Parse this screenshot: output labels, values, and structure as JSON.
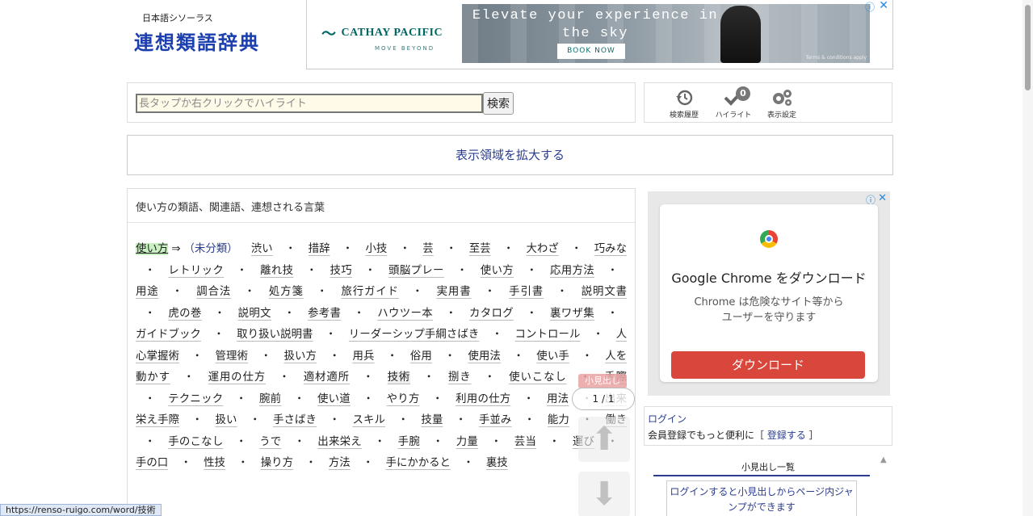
{
  "header": {
    "logo_sub": "日本語シソーラス",
    "logo_main": "連想類語辞典"
  },
  "ad_top": {
    "brand": "CATHAY PACIFIC",
    "tagline": "MOVE BEYOND",
    "headline": "Elevate your experience in the sky",
    "button": "BOOK NOW",
    "terms": "Terms & conditions apply",
    "info_icon": "info-icon",
    "close_icon": "close-icon"
  },
  "search": {
    "placeholder": "長タップか右クリックでハイライト",
    "value": "",
    "button_label": "検索"
  },
  "tools": {
    "history_label": "検索履歴",
    "highlight_label": "ハイライト",
    "highlight_count": "0",
    "settings_label": "表示設定"
  },
  "expand": {
    "label": "表示領域を拡大する"
  },
  "content": {
    "heading": "使い方の類語、関連語、連想される言葉",
    "head_word": "使い方",
    "arrow": "⇒",
    "category": "（未分類）",
    "words": [
      "渋い",
      "措辞",
      "小技",
      "芸",
      "至芸",
      "大わざ",
      "巧みな",
      "レトリック",
      "離れ技",
      "技巧",
      "頭脳プレー",
      "使い方",
      "応用方法",
      "用途",
      "調合法",
      "処方箋",
      "旅行ガイド",
      "実用書",
      "手引書",
      "説明文書",
      "虎の巻",
      "説明文",
      "参考書",
      "ハウツー本",
      "カタログ",
      "裏ワザ集",
      "ガイドブック",
      "取り扱い説明書",
      "リーダーシップ手綱さばき",
      "コントロール",
      "人心掌握術",
      "管理術",
      "扱い方",
      "用兵",
      "俗用",
      "使用法",
      "使い手",
      "人を動かす",
      "運用の仕方",
      "適材適所",
      "技術",
      "捌き",
      "使いこなし",
      "手際",
      "テクニック",
      "腕前",
      "使い道",
      "やり方",
      "利用の仕方",
      "用法",
      "出来栄え手際",
      "扱い",
      "手さばき",
      "スキル",
      "技量",
      "手並み",
      "能力",
      "働き",
      "手のこなし",
      "うで",
      "出来栄え",
      "手腕",
      "力量",
      "芸当",
      "運び",
      "手の口",
      "性技",
      "操り方",
      "方法",
      "手にかかると",
      "裏技"
    ]
  },
  "float_nav": {
    "tag": "小見出し",
    "count": "1 / 1"
  },
  "ad_side": {
    "title": "Google Chrome をダウンロード",
    "text": "Chrome は危険なサイト等から\nユーザーを守ります",
    "button": "ダウンロード"
  },
  "login": {
    "link": "ログイン",
    "msg_prefix": "会員登録でもっと便利に［ ",
    "register": "登録する",
    "msg_suffix": " ］"
  },
  "subheadings": {
    "title": "小見出し一覧",
    "note": "ログインすると小見出しからページ内ジャンプができます"
  },
  "status_bar": {
    "url": "https://renso-ruigo.com/word/技術"
  }
}
